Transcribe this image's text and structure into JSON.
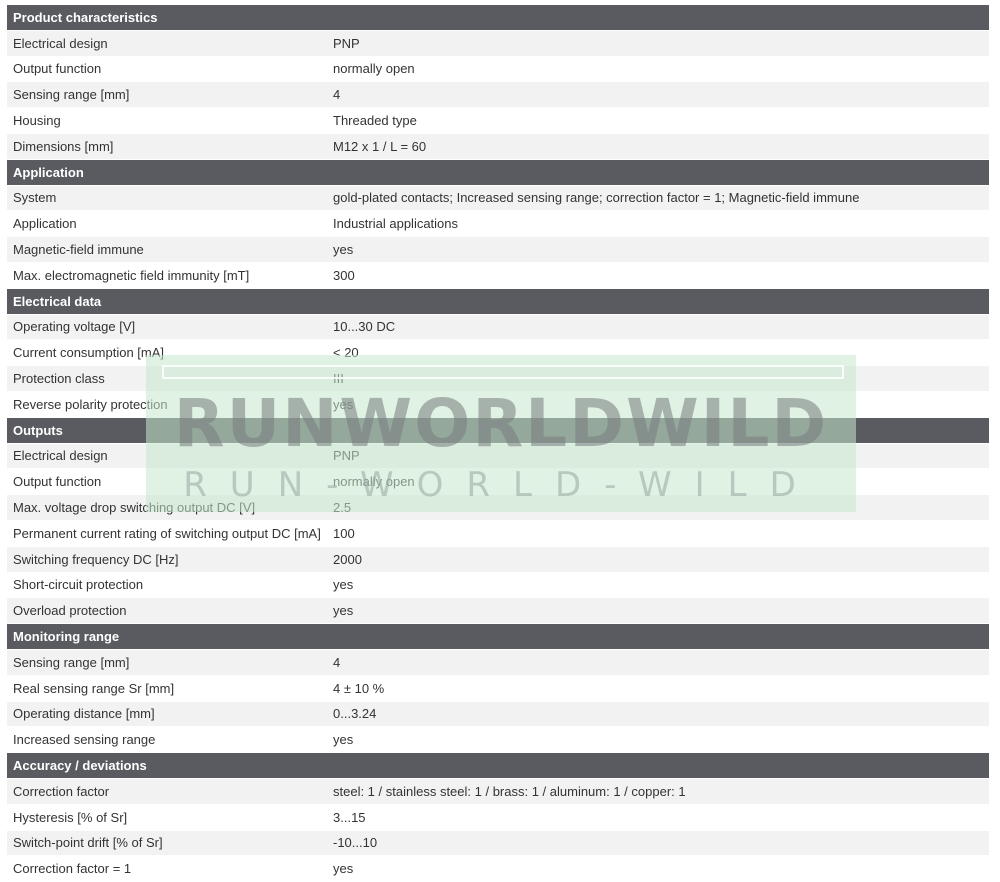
{
  "sections": [
    {
      "title": "Product characteristics",
      "rows": [
        [
          "Electrical design",
          "PNP"
        ],
        [
          "Output function",
          "normally open"
        ],
        [
          "Sensing range [mm]",
          "4"
        ],
        [
          "Housing",
          "Threaded type"
        ],
        [
          "Dimensions [mm]",
          "M12 x 1 / L = 60"
        ]
      ]
    },
    {
      "title": "Application",
      "rows": [
        [
          "System",
          "gold-plated contacts; Increased sensing range; correction factor = 1; Magnetic-field immune"
        ],
        [
          "Application",
          "Industrial applications"
        ],
        [
          "Magnetic-field immune",
          "yes"
        ],
        [
          "Max. electromagnetic field immunity [mT]",
          "300"
        ]
      ]
    },
    {
      "title": "Electrical data",
      "rows": [
        [
          "Operating voltage [V]",
          "10...30 DC"
        ],
        [
          "Current consumption [mA]",
          "< 20"
        ],
        [
          "Protection class",
          "III"
        ],
        [
          "Reverse polarity protection",
          "yes"
        ]
      ]
    },
    {
      "title": "Outputs",
      "rows": [
        [
          "Electrical design",
          "PNP"
        ],
        [
          "Output function",
          "normally open"
        ],
        [
          "Max. voltage drop switching output DC [V]",
          "2.5"
        ],
        [
          "Permanent current rating of switching output DC [mA]",
          "100"
        ],
        [
          "Switching frequency DC [Hz]",
          "2000"
        ],
        [
          "Short-circuit protection",
          "yes"
        ],
        [
          "Overload protection",
          "yes"
        ]
      ]
    },
    {
      "title": "Monitoring range",
      "rows": [
        [
          "Sensing range [mm]",
          "4"
        ],
        [
          "Real sensing range Sr [mm]",
          "4 ± 10 %"
        ],
        [
          "Operating distance [mm]",
          "0...3.24"
        ],
        [
          "Increased sensing range",
          "yes"
        ]
      ]
    },
    {
      "title": "Accuracy / deviations",
      "rows": [
        [
          "Correction factor",
          "steel: 1 / stainless steel: 1 / brass: 1 / aluminum: 1 / copper: 1"
        ],
        [
          "Hysteresis [% of Sr]",
          "3...15"
        ],
        [
          "Switch-point drift [% of Sr]",
          "-10...10"
        ],
        [
          "Correction factor = 1",
          "yes"
        ]
      ]
    }
  ],
  "watermark": {
    "line1": "RUNWORLDWILD",
    "line2": "RUN-WORLD-WILD"
  },
  "colors": {
    "header_bg": "#595b60",
    "header_text": "#ffffff",
    "row_alt": "#f2f2f2",
    "watermark_bg": "#c4e8cc"
  }
}
